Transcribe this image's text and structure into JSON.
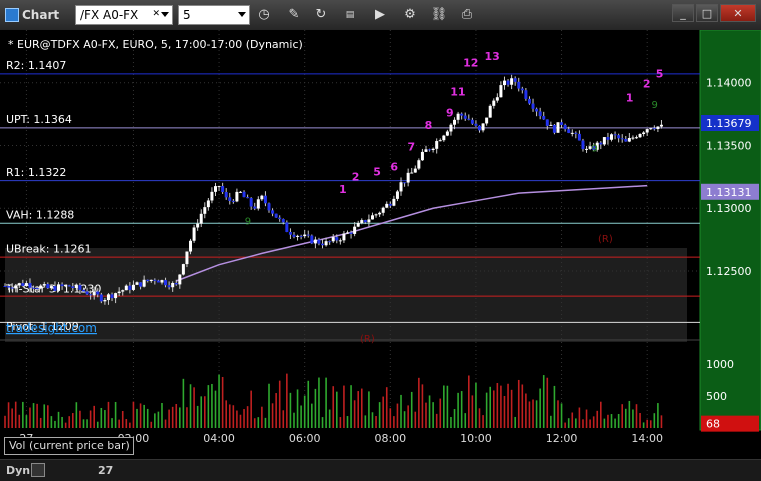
{
  "window": {
    "title": "Chart",
    "symbol_value": "/FX A0-FX",
    "period_value": "5"
  },
  "toolbar_icons": [
    "clock-icon",
    "pencil-icon",
    "refresh-icon",
    "studies-icon",
    "play-icon",
    "settings-icon",
    "link-icon",
    "print-icon"
  ],
  "header": {
    "description": "* EUR@TDFX A0-FX, EURO, 5, 17:00-17:00 (Dynamic)"
  },
  "levels": [
    {
      "label": "R2: 1.1407",
      "value": 1.1407,
      "color": "#1f2fd4",
      "label_y": 1.1414
    },
    {
      "label": "UPT: 1.1364",
      "value": 1.1364,
      "color": "#9b8fd6",
      "label_y": 1.1371
    },
    {
      "label": "R1: 1.1322",
      "value": 1.1322,
      "color": "#2f3fcf",
      "label_y": 1.1329
    },
    {
      "label": "VAH: 1.1288",
      "value": 1.1288,
      "color": "#8ad0d0",
      "label_y": 1.1295
    },
    {
      "label": "UBreak: 1.1261",
      "value": 1.1261,
      "color": "#cc2020",
      "label_y": 1.1268
    },
    {
      "label": "Tri-Star 3: 1.1230",
      "value": 1.123,
      "color": "#cc2020",
      "label_y": 1.1236
    },
    {
      "label": "Pivot: 1.1209",
      "value": 1.1209,
      "color": "#dddddd",
      "label_y": 1.1206
    }
  ],
  "price_axis": {
    "ticks": [
      1.14,
      1.135,
      1.13,
      1.125
    ],
    "tick_labels": [
      "1.14000",
      "1.13500",
      "1.13000",
      "1.12500"
    ],
    "current_price": "1.13679",
    "current_value": 1.13679,
    "secondary_price": "1.13131",
    "secondary_value": 1.13131,
    "range": [
      1.1195,
      1.1442
    ]
  },
  "time_axis": {
    "labels": [
      "27",
      "02:00",
      "04:00",
      "06:00",
      "08:00",
      "10:00",
      "12:00",
      "14:00"
    ],
    "hours": [
      -0.5,
      2,
      4,
      6,
      8,
      10,
      12,
      14
    ]
  },
  "volume": {
    "label": "Vol (current price bar)",
    "ticks": [
      "1000",
      "500"
    ],
    "tick_values": [
      1000,
      500
    ],
    "current": "68",
    "current_value": 68,
    "max": 1250
  },
  "annotations": {
    "watermark": "tradesight.com",
    "r_label_1": "(R)",
    "r_label_2": "(R)",
    "seq": [
      "1",
      "2",
      "5",
      "6",
      "7",
      "8",
      "9",
      "11",
      "12",
      "13",
      "1",
      "2",
      "5"
    ],
    "green_counts": [
      "9",
      "9",
      "9"
    ]
  },
  "bottom": {
    "mode": "Dyn",
    "date_label": "27"
  },
  "chart_data": {
    "type": "candlestick",
    "x_unit": "hours",
    "x_range": [
      -1,
      15
    ],
    "close_path": [
      [
        -1,
        1.1238
      ],
      [
        -0.5,
        1.124
      ],
      [
        0,
        1.1236
      ],
      [
        0.5,
        1.1238
      ],
      [
        1,
        1.1232
      ],
      [
        1.3,
        1.1228
      ],
      [
        1.6,
        1.1233
      ],
      [
        2,
        1.1238
      ],
      [
        2.5,
        1.1244
      ],
      [
        3,
        1.1238
      ],
      [
        3.2,
        1.1262
      ],
      [
        3.5,
        1.129
      ],
      [
        3.8,
        1.131
      ],
      [
        4.0,
        1.1318
      ],
      [
        4.2,
        1.1305
      ],
      [
        4.5,
        1.1312
      ],
      [
        4.8,
        1.13
      ],
      [
        5.0,
        1.1308
      ],
      [
        5.3,
        1.1295
      ],
      [
        5.6,
        1.1282
      ],
      [
        5.9,
        1.1278
      ],
      [
        6.2,
        1.1274
      ],
      [
        6.5,
        1.1272
      ],
      [
        6.8,
        1.1276
      ],
      [
        7.1,
        1.1282
      ],
      [
        7.4,
        1.129
      ],
      [
        7.7,
        1.1296
      ],
      [
        8.0,
        1.1305
      ],
      [
        8.2,
        1.1318
      ],
      [
        8.5,
        1.1328
      ],
      [
        8.8,
        1.1345
      ],
      [
        9.0,
        1.135
      ],
      [
        9.3,
        1.1362
      ],
      [
        9.6,
        1.1375
      ],
      [
        9.8,
        1.1372
      ],
      [
        10.1,
        1.136
      ],
      [
        10.3,
        1.1378
      ],
      [
        10.6,
        1.1398
      ],
      [
        10.9,
        1.1402
      ],
      [
        11.2,
        1.1388
      ],
      [
        11.5,
        1.1375
      ],
      [
        11.8,
        1.1362
      ],
      [
        12.0,
        1.1368
      ],
      [
        12.3,
        1.1358
      ],
      [
        12.6,
        1.1345
      ],
      [
        12.9,
        1.1352
      ],
      [
        13.2,
        1.1358
      ],
      [
        13.5,
        1.1352
      ],
      [
        13.8,
        1.136
      ],
      [
        14.1,
        1.1366
      ],
      [
        14.4,
        1.1364
      ]
    ],
    "moving_average": [
      [
        3,
        1.1242
      ],
      [
        4,
        1.1255
      ],
      [
        5,
        1.1264
      ],
      [
        6,
        1.1272
      ],
      [
        7,
        1.128
      ],
      [
        8,
        1.129
      ],
      [
        9,
        1.13
      ],
      [
        10,
        1.1306
      ],
      [
        11,
        1.1312
      ],
      [
        12,
        1.1314
      ],
      [
        13,
        1.1316
      ],
      [
        14,
        1.1318
      ]
    ]
  }
}
